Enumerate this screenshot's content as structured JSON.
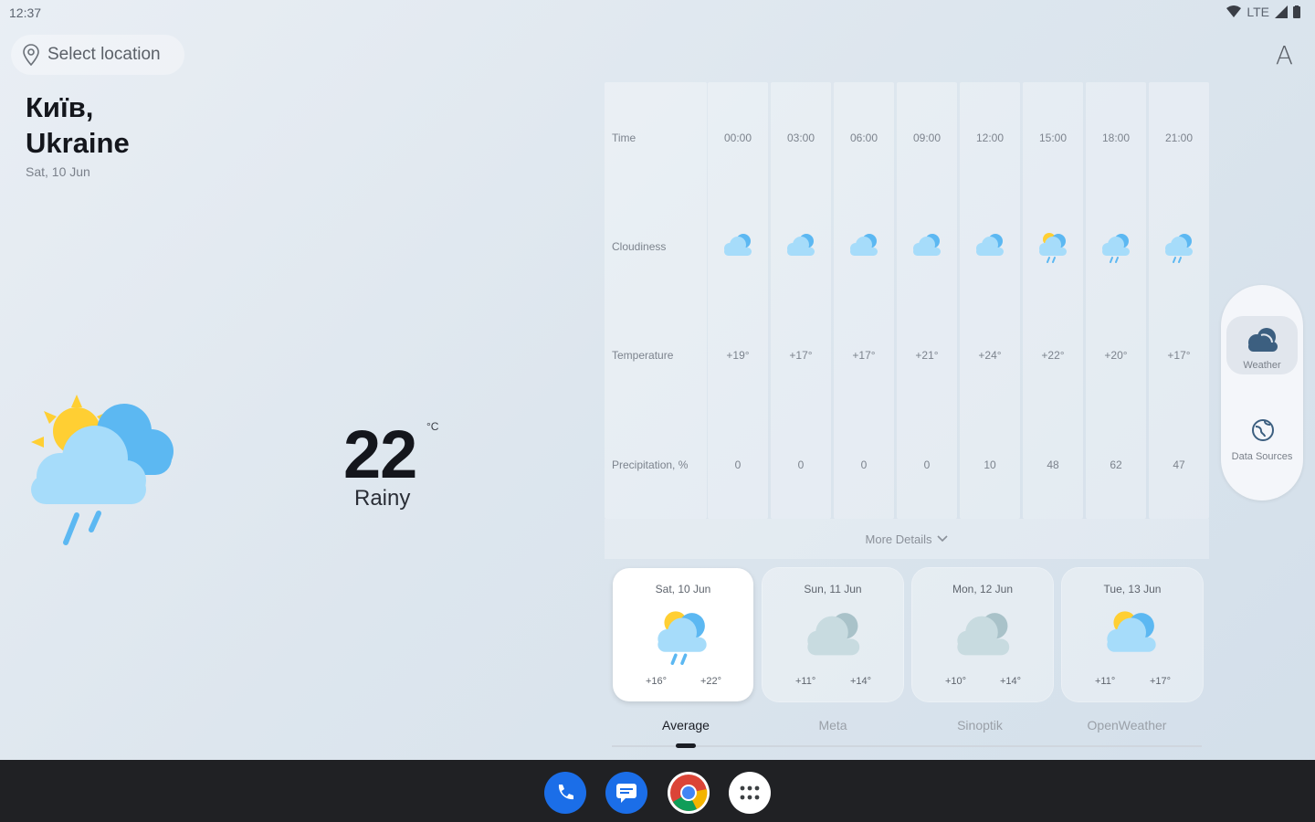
{
  "status": {
    "time": "12:37",
    "network": "LTE"
  },
  "header": {
    "location_btn": "Select location",
    "font_btn": "A"
  },
  "current": {
    "city_line1": "Київ,",
    "city_line2": "Ukraine",
    "date": "Sat, 10 Jun",
    "temp": "22",
    "unit": "°C",
    "condition": "Rainy",
    "icon": "sun-cloud-rain-icon"
  },
  "hourly": {
    "labels": {
      "time": "Time",
      "cloudiness": "Cloudiness",
      "temperature": "Temperature",
      "precip": "Precipitation, %"
    },
    "columns": [
      {
        "time": "00:00",
        "temp": "+19°",
        "precip": "0",
        "icon": "cloud-icon"
      },
      {
        "time": "03:00",
        "temp": "+17°",
        "precip": "0",
        "icon": "cloud-icon"
      },
      {
        "time": "06:00",
        "temp": "+17°",
        "precip": "0",
        "icon": "cloud-icon"
      },
      {
        "time": "09:00",
        "temp": "+21°",
        "precip": "0",
        "icon": "cloud-icon"
      },
      {
        "time": "12:00",
        "temp": "+24°",
        "precip": "10",
        "icon": "cloud-icon"
      },
      {
        "time": "15:00",
        "temp": "+22°",
        "precip": "48",
        "icon": "sun-cloud-rain-icon"
      },
      {
        "time": "18:00",
        "temp": "+20°",
        "precip": "62",
        "icon": "cloud-rain-icon"
      },
      {
        "time": "21:00",
        "temp": "+17°",
        "precip": "47",
        "icon": "cloud-rain-icon"
      }
    ],
    "more": "More Details"
  },
  "days": [
    {
      "label": "Sat, 10 Jun",
      "lo": "+16°",
      "hi": "+22°",
      "icon": "sun-cloud-rain-icon"
    },
    {
      "label": "Sun, 11 Jun",
      "lo": "+11°",
      "hi": "+14°",
      "icon": "cloudy-icon"
    },
    {
      "label": "Mon, 12 Jun",
      "lo": "+10°",
      "hi": "+14°",
      "icon": "cloudy-icon"
    },
    {
      "label": "Tue, 13 Jun",
      "lo": "+11°",
      "hi": "+17°",
      "icon": "sun-cloud-icon"
    }
  ],
  "tabs": [
    "Average",
    "Meta",
    "Sinoptik",
    "OpenWeather"
  ],
  "rail": {
    "weather": "Weather",
    "sources": "Data Sources"
  },
  "colors": {
    "accent_blue": "#4fb7f0",
    "sun": "#ffd23d",
    "navbar": "#202124"
  }
}
